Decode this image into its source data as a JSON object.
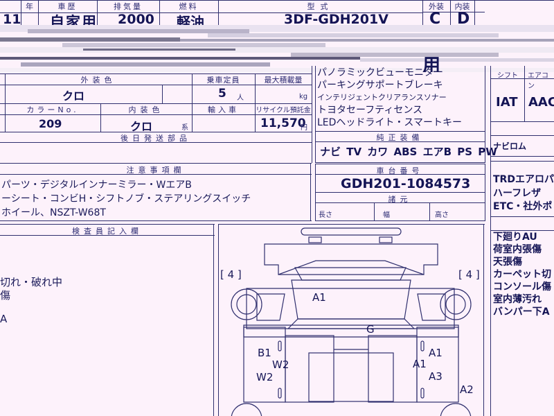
{
  "top": {
    "year_label": "年",
    "history_label": "車歴",
    "displacement_label": "排気量",
    "fuel_label": "燃料",
    "model_label": "型式",
    "exterior_grade_label": "外装",
    "interior_grade_label": "内装",
    "year_value": "11",
    "history_value": "自家用",
    "displacement_value": "2000",
    "fuel_value": "軽油",
    "model_value": "3DF-GDH201V",
    "exterior_grade": "C",
    "interior_grade": "D",
    "extra_fragment": "用"
  },
  "body_color": {
    "exterior_label": "外装色",
    "exterior_value": "クロ",
    "capacity_label": "乗車定員",
    "capacity_value": "5",
    "capacity_unit": "人",
    "max_load_label": "最大積載量",
    "max_load_unit": "kg",
    "color_no_label": "カラーNo.",
    "color_no_value": "209",
    "interior_label": "内装色",
    "interior_value": "クロ",
    "interior_unit": "系",
    "import_label": "輸入車",
    "recycle_label": "リサイクル預託金",
    "recycle_value": "11,570",
    "recycle_unit": "円"
  },
  "features": {
    "lines": [
      "パノラミックビューモニター",
      "パーキングサポートブレーキ",
      "インテリジェントクリアランスソナー",
      "トヨタセーフティセンス",
      "LEDヘッドライト・スマートキー"
    ],
    "genuine_label": "純正装備",
    "genuine_values": "ナビ TV カワ ABS エアB PS PW"
  },
  "right_panel": {
    "shift_label": "シフト",
    "shift_value": "IAT",
    "aircon_label": "エアコン",
    "aircon_value": "AAC",
    "nav_value": "ナビロム",
    "options": [
      "TRDエアロパ",
      "ハーフレザ",
      "ETC・社外ポ"
    ],
    "damages": [
      "下廻りAU",
      "荷室内張傷",
      "天張傷",
      "カーペット切",
      "コンソール傷",
      "室内薄汚れ",
      "バンパー下A"
    ]
  },
  "later_parts": {
    "label": "後日発送部品"
  },
  "notes": {
    "label": "注意事項欄",
    "lines": [
      "パーツ・デジタルインナーミラー・WエアB",
      "ーシート・コンビH・シフトノブ・ステアリングスイッチ",
      "ホイール、NSZT-W68T"
    ]
  },
  "chassis": {
    "label": "車台番号",
    "value": "GDH201-1084573",
    "dims_label": "諸元",
    "length_label": "長さ",
    "width_label": "幅",
    "height_label": "高さ"
  },
  "inspector": {
    "label": "検査員記入欄",
    "lines": [
      "切れ・破れ中",
      "傷",
      "A"
    ]
  },
  "diagram": {
    "left_tire": "[ 4 ]",
    "right_tire": "[ 4 ]",
    "marks": [
      "A1",
      "G",
      "B1",
      "W2",
      "W2",
      "A1",
      "A1",
      "A3",
      "A2"
    ]
  }
}
